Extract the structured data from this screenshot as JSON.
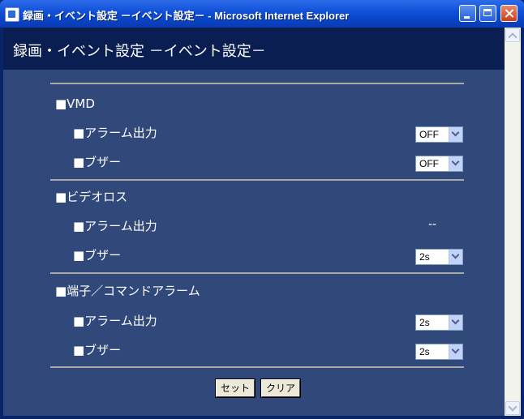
{
  "window": {
    "title": "録画・イベント設定 －イベント設定－ - Microsoft Internet Explorer"
  },
  "page": {
    "title": "録画・イベント設定 －イベント設定－"
  },
  "sections": [
    {
      "label": "■VMD",
      "rows": [
        {
          "label": "■アラーム出力",
          "value": "OFF"
        },
        {
          "label": "■ブザー",
          "value": "OFF"
        }
      ]
    },
    {
      "label": "■ビデオロス",
      "rows": [
        {
          "label": "■アラーム出力",
          "value": "--"
        },
        {
          "label": "■ブザー",
          "value": "2s"
        }
      ]
    },
    {
      "label": "■端子／コマンドアラーム",
      "rows": [
        {
          "label": "■アラーム出力",
          "value": "2s"
        },
        {
          "label": "■ブザー",
          "value": "2s"
        }
      ]
    }
  ],
  "buttons": {
    "set": "セット",
    "clear": "クリア"
  },
  "icons": [
    "ie-page-icon",
    "minimize-icon",
    "maximize-icon",
    "close-icon",
    "scroll-up-icon",
    "scroll-down-icon"
  ],
  "colors": {
    "titlebar": "#0F4FD8",
    "header_band": "#0A1E52",
    "content_bg": "#30497A"
  }
}
